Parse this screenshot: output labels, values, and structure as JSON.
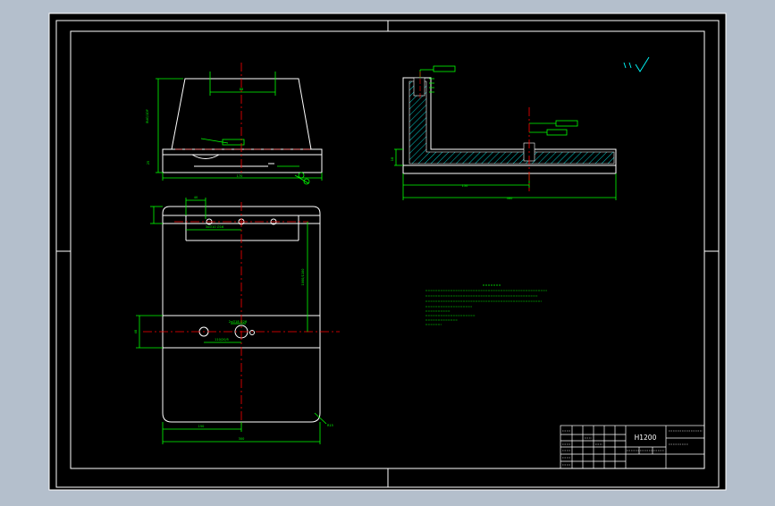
{
  "colors": {
    "background": "#b4bfcc",
    "paper": "#000000",
    "outline": "#ffffff",
    "dimension": "#00ff00",
    "centerline": "#ff0000",
    "hatch": "#00ffff",
    "note": "#00ff00",
    "symbol": "#00ffff"
  },
  "title_block": {
    "drawing_number": "H1200"
  }
}
